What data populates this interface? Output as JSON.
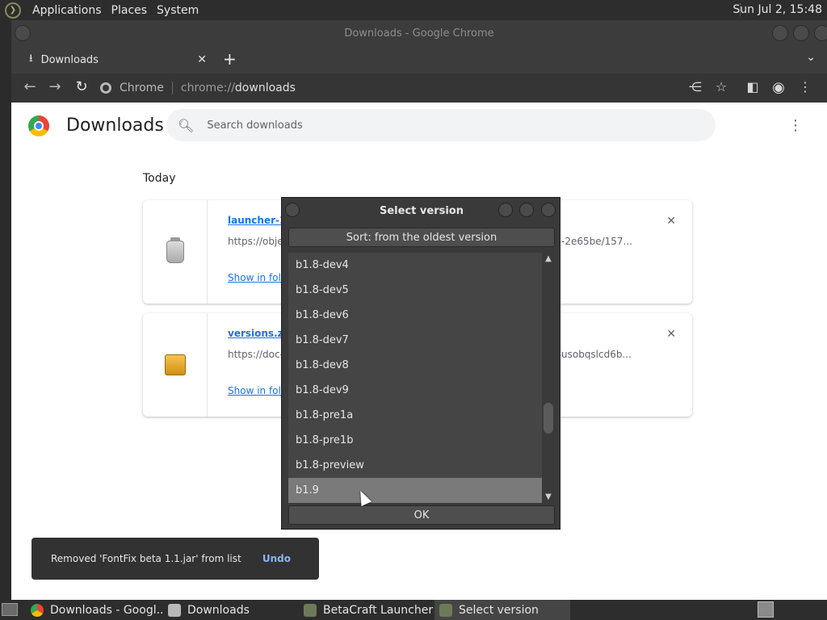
{
  "top_panel": {
    "menus": [
      "Applications",
      "Places",
      "System"
    ],
    "clock": "Sun Jul  2, 15:48"
  },
  "window": {
    "title": "Downloads - Google Chrome",
    "tab": {
      "label": "Downloads"
    }
  },
  "omnibox": {
    "site_label": "Chrome",
    "scheme": "chrome://",
    "host": "downloads"
  },
  "page": {
    "title": "Downloads",
    "search_placeholder": "Search downloads",
    "date_section": "Today",
    "items": [
      {
        "file_name": "launcher-1.",
        "url": "https://obje",
        "url_tail": "-2e65be/157...",
        "show_in_folder": "Show in fold",
        "icon": "jar-file-icon"
      },
      {
        "file_name": "versions.zip",
        "url": "https://doc-",
        "url_tail": "usobqslcd6b...",
        "show_in_folder": "Show in fold",
        "icon": "archive-file-icon"
      }
    ],
    "toast": {
      "message": "Removed 'FontFix beta 1.1.jar' from list",
      "action": "Undo"
    }
  },
  "dialog": {
    "title": "Select version",
    "sort_label": "Sort: from the oldest version",
    "versions": [
      "b1.8-dev4",
      "b1.8-dev5",
      "b1.8-dev6",
      "b1.8-dev7",
      "b1.8-dev8",
      "b1.8-dev9",
      "b1.8-pre1a",
      "b1.8-pre1b",
      "b1.8-preview",
      "b1.9"
    ],
    "selected_index": 9,
    "ok_label": "OK"
  },
  "taskbar": {
    "items": [
      {
        "label": "Downloads - Googl...",
        "icon": "chrome-icon"
      },
      {
        "label": "Downloads",
        "icon": "folder-icon"
      },
      {
        "label": "BetaCraft Launcher ...",
        "icon": "betacraft-icon"
      },
      {
        "label": "Select version",
        "icon": "betacraft-icon",
        "active": true
      }
    ]
  }
}
